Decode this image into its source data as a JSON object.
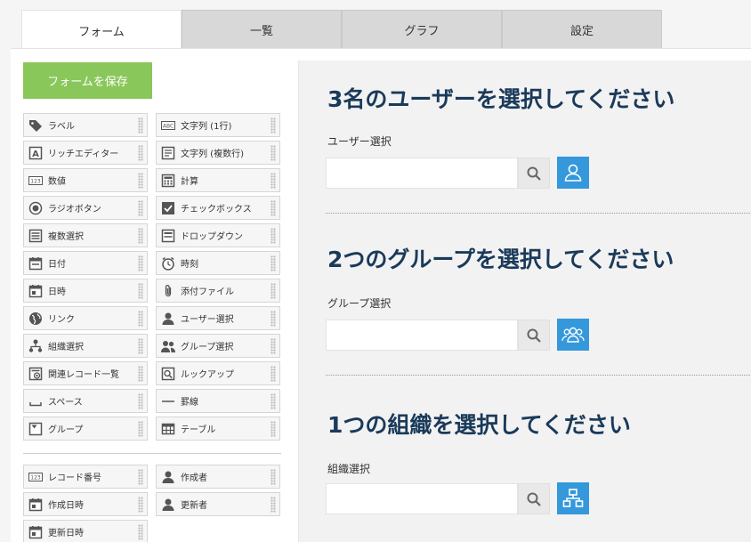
{
  "tabs": [
    {
      "label": "フォーム",
      "active": true
    },
    {
      "label": "一覧"
    },
    {
      "label": "グラフ"
    },
    {
      "label": "設定"
    }
  ],
  "save_button": "フォームを保存",
  "palette": {
    "left": [
      "ラベル",
      "リッチエディター",
      "数値",
      "ラジオボタン",
      "複数選択",
      "日付",
      "日時",
      "リンク",
      "組織選択",
      "関連レコード一覧",
      "スペース",
      "グループ"
    ],
    "right": [
      "文字列 (1行)",
      "文字列 (複数行)",
      "計算",
      "チェックボックス",
      "ドロップダウン",
      "時刻",
      "添付ファイル",
      "ユーザー選択",
      "グループ選択",
      "ルックアップ",
      "罫線",
      "テーブル"
    ],
    "system_left": [
      "レコード番号",
      "作成日時",
      "更新日時"
    ],
    "system_right": [
      "作成者",
      "更新者"
    ]
  },
  "sections": [
    {
      "title": "3名のユーザーを選択してください",
      "label": "ユーザー選択",
      "value": ""
    },
    {
      "title": "2つのグループを選択してください",
      "label": "グループ選択",
      "value": ""
    },
    {
      "title": "1つの組織を選択してください",
      "label": "組織選択",
      "value": ""
    }
  ],
  "colors": {
    "accent": "#3498db",
    "save": "#8ac75a",
    "heading": "#1a3a5a"
  }
}
